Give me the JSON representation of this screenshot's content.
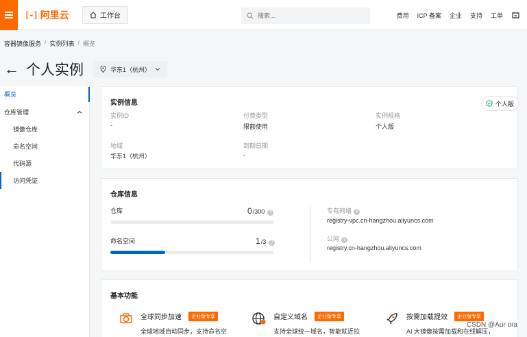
{
  "topbar": {
    "logo_text": "阿里云",
    "logo_mark": "[-]",
    "workbench": "工作台",
    "search_placeholder": "搜索...",
    "links": [
      "费用",
      "ICP 备案",
      "企业",
      "支持",
      "工单"
    ]
  },
  "breadcrumb": [
    "容器镜像服务",
    "实例列表",
    "概览"
  ],
  "page": {
    "back": "←",
    "title": "个人实例",
    "region": "华东1（杭州）"
  },
  "sidebar": {
    "items": [
      "概览",
      "仓库管理",
      "镜像仓库",
      "命名空间",
      "代码源",
      "访问凭证"
    ]
  },
  "instance_info": {
    "title": "实例信息",
    "badge": "个人版",
    "fields": [
      {
        "label": "实例ID",
        "value": "-"
      },
      {
        "label": "付费类型",
        "value": "限额使用"
      },
      {
        "label": "实例规格",
        "value": "个人版"
      },
      {
        "label": "地域",
        "value": "华东1（杭州）"
      },
      {
        "label": "到期日期",
        "value": "-"
      }
    ]
  },
  "repo_info": {
    "title": "仓库信息",
    "repo": {
      "label": "仓库",
      "used": "0",
      "limit": "/300",
      "fraction": 0.0
    },
    "namespace": {
      "label": "命名空间",
      "used": "1",
      "limit": "/3",
      "fraction": 0.333
    },
    "vpc": {
      "label": "专有网络",
      "value": "registry-vpc.cn-hangzhou.aliyuncs.com"
    },
    "public": {
      "label": "公网",
      "value": "registry.cn-hangzhou.aliyuncs.com"
    }
  },
  "basic_features": {
    "title": "基本功能",
    "items": [
      {
        "name": "全球同步加速",
        "tag": "企业版专享",
        "desc": "全球地域自动同步，支持命名空"
      },
      {
        "name": "自定义域名",
        "tag": "企业版专享",
        "desc": "支持全球统一域名，智能就近拉"
      },
      {
        "name": "按需加载提效",
        "tag": "企业版专享",
        "desc": "AI 大镜像按需加载和在线解压，"
      }
    ]
  },
  "watermark": "CSDN @Aur ora",
  "colors": {
    "brand": "#ff6a00",
    "primary": "#0064c8"
  }
}
